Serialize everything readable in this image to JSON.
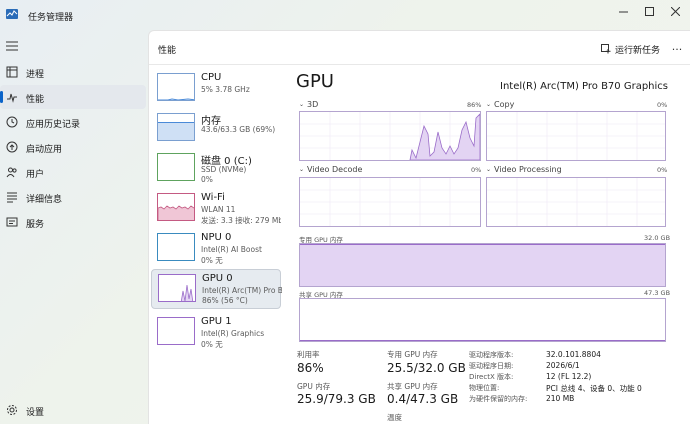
{
  "window": {
    "title": "任务管理器",
    "controls": [
      "minimize",
      "maximize",
      "close"
    ]
  },
  "sidebar": {
    "items": [
      {
        "label": "进程",
        "icon": "processes-icon"
      },
      {
        "label": "性能",
        "icon": "performance-icon",
        "active": true
      },
      {
        "label": "应用历史记录",
        "icon": "app-history-icon"
      },
      {
        "label": "启动应用",
        "icon": "startup-icon"
      },
      {
        "label": "用户",
        "icon": "users-icon"
      },
      {
        "label": "详细信息",
        "icon": "details-icon"
      },
      {
        "label": "服务",
        "icon": "services-icon"
      }
    ],
    "settings_label": "设置"
  },
  "header": {
    "title": "性能",
    "run_task_label": "运行新任务",
    "more_label": "..."
  },
  "devices": [
    {
      "name": "CPU",
      "sub1": "5% 3.78 GHz",
      "sub2": ""
    },
    {
      "name": "内存",
      "sub1": "43.6/63.3 GB (69%)",
      "sub2": ""
    },
    {
      "name": "磁盘 0 (C:)",
      "sub1": "SSD (NVMe)",
      "sub2": "0%"
    },
    {
      "name": "Wi-Fi",
      "sub1": "WLAN 11",
      "sub2": "发送: 3.3 接收: 279 Mb"
    },
    {
      "name": "NPU 0",
      "sub1": "Intel(R) AI Boost",
      "sub2": "0% 无"
    },
    {
      "name": "GPU 0",
      "sub1": "Intel(R) Arc(TM) Pro B",
      "sub2": "86% (56 °C)",
      "selected": true
    },
    {
      "name": "GPU 1",
      "sub1": "Intel(R) Graphics",
      "sub2": "0% 无"
    }
  ],
  "gpu": {
    "title": "GPU",
    "model": "Intel(R) Arc(TM) Pro B70 Graphics",
    "engines": [
      {
        "label": "3D",
        "pct": "86%"
      },
      {
        "label": "Copy",
        "pct": "0%"
      },
      {
        "label": "Video Decode",
        "pct": "0%"
      },
      {
        "label": "Video Processing",
        "pct": "0%"
      }
    ],
    "dedicated_label": "专用 GPU 内存",
    "dedicated_max": "32.0 GB",
    "dedicated_fill": 1.0,
    "shared_label": "共享 GPU 内存",
    "shared_max": "47.3 GB",
    "shared_fill": 0.01
  },
  "stats": {
    "utilization_label": "利用率",
    "utilization_value": "86%",
    "dedicated_mem_label": "专用 GPU 内存",
    "dedicated_mem_value": "25.5/32.0 GB",
    "gpu_mem_label": "GPU 内存",
    "gpu_mem_value": "25.9/79.3 GB",
    "shared_mem_label": "共享 GPU 内存",
    "shared_mem_value": "0.4/47.3 GB",
    "temp_label": "温度"
  },
  "driver_info": [
    {
      "label": "驱动程序版本:",
      "value": "32.0.101.8804"
    },
    {
      "label": "驱动程序日期:",
      "value": "2026/6/1"
    },
    {
      "label": "DirectX 版本:",
      "value": "12 (FL 12.2)"
    },
    {
      "label": "物理位置:",
      "value": "PCI 总线 4、设备 0、功能 0"
    },
    {
      "label": "为硬件保留的内存:",
      "value": "210 MB"
    }
  ],
  "colors": {
    "accent": "#0a63c9",
    "gpu_purple": "#9a6cc9",
    "gpu_fill": "#e3d4f3",
    "mem_blue": "#cfe0f5",
    "wifi_pink": "#e8b3c6"
  }
}
